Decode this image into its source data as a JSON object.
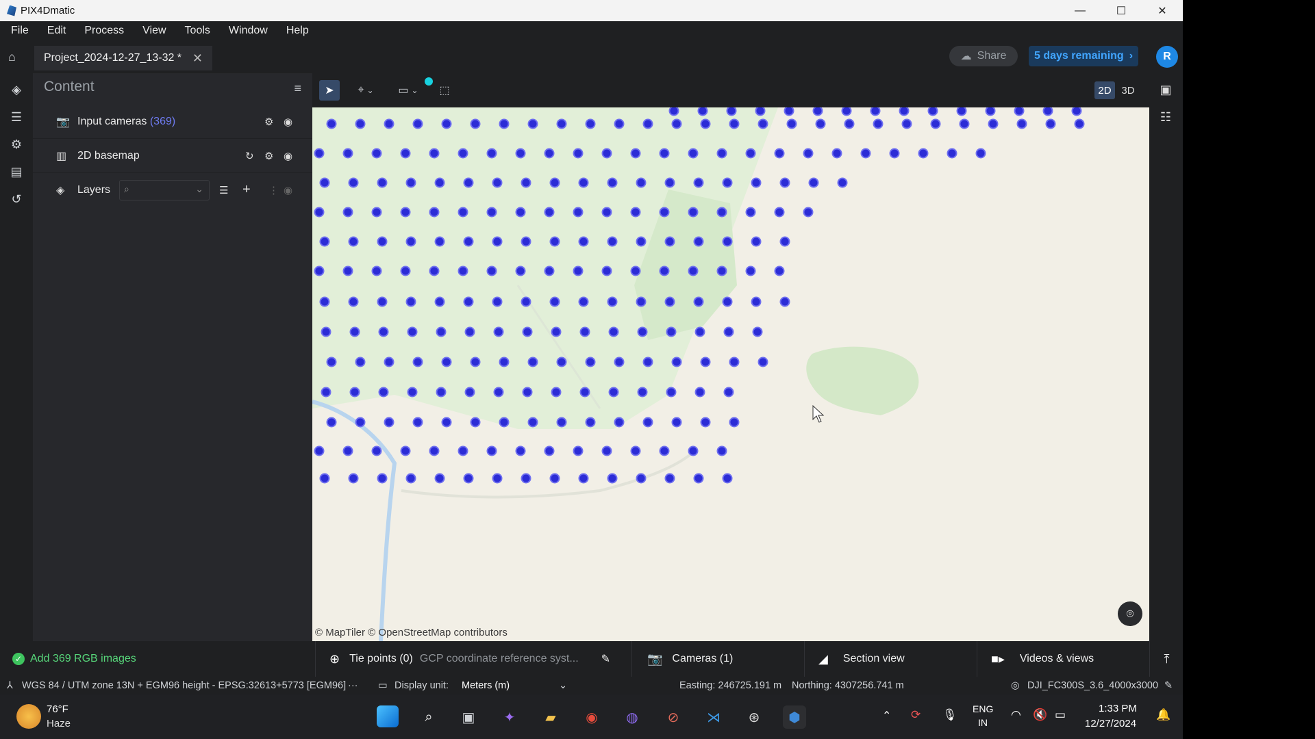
{
  "window": {
    "title": "PIX4Dmatic",
    "controls": [
      "—",
      "☐",
      "✕"
    ]
  },
  "menu": [
    "File",
    "Edit",
    "Process",
    "View",
    "Tools",
    "Window",
    "Help"
  ],
  "tab": {
    "title": "Project_2024-12-27_13-32 *"
  },
  "header": {
    "share_label": "Share",
    "trial_label": "5 days remaining",
    "avatar_initial": "R"
  },
  "content_panel": {
    "title": "Content",
    "rows": [
      {
        "label": "Input cameras",
        "count": "(369)"
      },
      {
        "label": "2D basemap"
      },
      {
        "label": "Layers"
      }
    ]
  },
  "view_toggle": {
    "two_d": "2D",
    "three_d": "3D"
  },
  "map": {
    "attribution": "© MapTiler  © OpenStreetMap contributors"
  },
  "bottom_bar": {
    "status": "Add 369 RGB images",
    "tie_points": "Tie points (0)",
    "gcp_crs": "GCP coordinate reference syst...",
    "cameras": "Cameras (1)",
    "section_view": "Section view",
    "videos_views": "Videos & views"
  },
  "status_line": {
    "crs": "WGS 84 / UTM zone 13N + EGM96 height - EPSG:32613+5773 [EGM96]",
    "more": "···",
    "display_unit_label": "Display unit:",
    "display_unit_value": "Meters (m)",
    "easting": "Easting: 246725.191 m",
    "northing": "Northing: 4307256.741 m",
    "image": "DJI_FC300S_3.6_4000x3000"
  },
  "taskbar": {
    "weather_temp": "76°F",
    "weather_cond": "Haze",
    "lang1": "ENG",
    "lang2": "IN",
    "time": "1:33 PM",
    "date": "12/27/2024"
  },
  "colors": {
    "camera_dot": "#2c2cd6",
    "accent": "#41a5ff",
    "map_bg": "#f2efe6",
    "map_green": "#dcecd2",
    "river": "#b8d4ee"
  }
}
